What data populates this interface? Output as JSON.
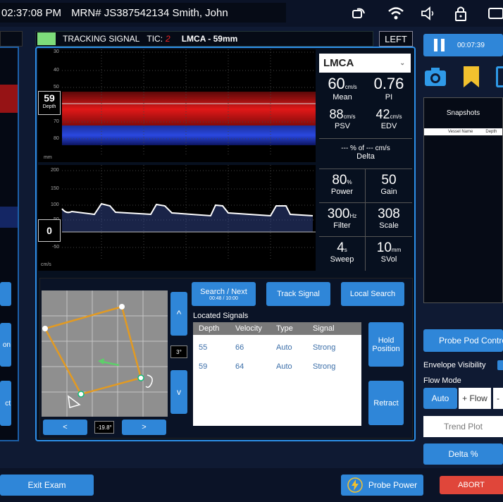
{
  "header": {
    "time": "02:37:08 PM",
    "mrn": "MRN# JS387542134 Smith, John"
  },
  "tracking": {
    "label": "TRACKING SIGNAL",
    "tic_label": "TIC:",
    "tic_value": "2",
    "vessel_depth": "LMCA - 59mm",
    "side": "LEFT",
    "indicator_color": "#7ddc7a"
  },
  "mmode": {
    "ticks": [
      "30",
      "40",
      "50",
      "60",
      "70",
      "80"
    ],
    "unit": "mm",
    "depth_value": "59",
    "depth_label": "Depth"
  },
  "spectral": {
    "ticks": [
      "200",
      "150",
      "100",
      "50",
      "0",
      "-50"
    ],
    "unit": "cm/s",
    "baseline": "0"
  },
  "vessel_select": "LMCA",
  "metrics": {
    "mean_value": "60",
    "mean_unit": "cm/s",
    "mean_label": "Mean",
    "pi_value": "0.76",
    "pi_label": "PI",
    "psv_value": "88",
    "psv_unit": "cm/s",
    "psv_label": "PSV",
    "edv_value": "42",
    "edv_unit": "cm/s",
    "edv_label": "EDV",
    "delta_line": "--- % of --- cm/s",
    "delta_label": "Delta",
    "power_value": "80",
    "power_unit": "%",
    "power_label": "Power",
    "gain_value": "50",
    "gain_label": "Gain",
    "filter_value": "300",
    "filter_unit": "Hz",
    "filter_label": "Filter",
    "scale_value": "308",
    "scale_label": "Scale",
    "sweep_value": "4",
    "sweep_unit": "s",
    "sweep_label": "Sweep",
    "svol_value": "10",
    "svol_unit": "mm",
    "svol_label": "SVol"
  },
  "controls": {
    "search_next": "Search / Next",
    "search_time": "00:48 / 10:00",
    "track_signal": "Track Signal",
    "local_search": "Local Search",
    "hold_position": "Hold Position",
    "retract": "Retract",
    "angle_vertical": "3°",
    "angle_horizontal": "-19.8°",
    "up": "^",
    "down": "v",
    "left": "<",
    "right": ">"
  },
  "located_signals": {
    "title": "Located Signals",
    "headers": [
      "Depth",
      "Velocity",
      "Type",
      "Signal"
    ],
    "rows": [
      [
        "55",
        "66",
        "Auto",
        "Strong"
      ],
      [
        "59",
        "64",
        "Auto",
        "Strong"
      ]
    ]
  },
  "right_panel": {
    "timer": "00:07:39",
    "snapshots_title": "Snapshots",
    "snap_col1": "Vessel Name",
    "snap_col2": "Depth",
    "probe_pod": "Probe Pod Contro",
    "envelope": "Envelope Visibility",
    "flow_mode": "Flow Mode",
    "auto": "Auto",
    "plus_flow": "+ Flow",
    "minus": "-",
    "trend_plot": "Trend Plot",
    "delta_pct": "Delta %"
  },
  "left_edge": {
    "btn_on": "on",
    "btn_ct": "ct"
  },
  "footer": {
    "exit": "Exit Exam",
    "probe_power": "Probe Power",
    "abort": "ABORT"
  }
}
